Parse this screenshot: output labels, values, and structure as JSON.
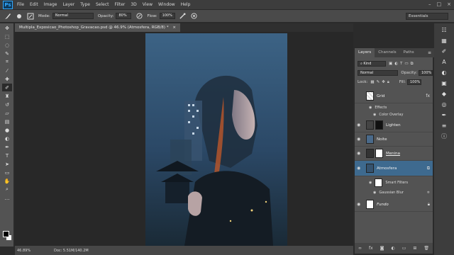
{
  "app": {
    "logo": "Ps"
  },
  "menu": [
    "File",
    "Edit",
    "Image",
    "Layer",
    "Type",
    "Select",
    "Filter",
    "3D",
    "View",
    "Window",
    "Help"
  ],
  "window_controls": [
    "–",
    "□",
    "×"
  ],
  "options": {
    "mode_label": "Mode:",
    "mode_value": "Normal",
    "opacity_label": "Opacity:",
    "opacity_value": "80%",
    "flow_label": "Flow:",
    "flow_value": "100%",
    "workspace": "Essentials"
  },
  "document": {
    "tab_title": "Multipla_Exposicao_Photoshop_Gravacao.psd @ 46.9% (Atmosfera, RGB/8) *",
    "zoom": "46.89%",
    "doc_info": "Doc: 5.51M/140.2M"
  },
  "layers_panel": {
    "tabs": [
      "Layers",
      "Channels",
      "Paths"
    ],
    "kind_label": "Kind",
    "blend_mode": "Normal",
    "opacity_label": "Opacity:",
    "opacity_value": "100%",
    "lock_label": "Lock:",
    "fill_label": "Fill:",
    "fill_value": "100%",
    "layers": [
      {
        "name": "Grid",
        "fx": "fx",
        "effects_label": "Effects",
        "effect": "Color Overlay"
      },
      {
        "name": "Lighten"
      },
      {
        "name": "Noite"
      },
      {
        "name": "Menina"
      },
      {
        "name": "Atmosfera",
        "smart_filters": "Smart Filters",
        "filter": "Gaussian Blur"
      },
      {
        "name": "Fundo"
      }
    ]
  },
  "colors": {
    "accent_selected": "#3e6a8f",
    "ps_blue": "#31a8ff"
  }
}
